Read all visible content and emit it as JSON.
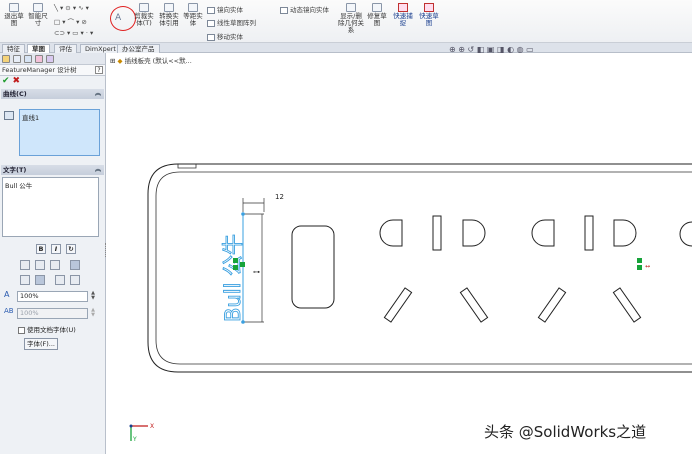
{
  "ribbon": {
    "buttons": [
      {
        "label": "退出草图",
        "name": "exit-sketch-button"
      },
      {
        "label": "智能尺寸",
        "name": "smart-dimension-button"
      },
      {
        "label": "剪裁实体(T)",
        "name": "trim-entities-button"
      },
      {
        "label": "转换实体引用",
        "name": "convert-entities-button"
      },
      {
        "label": "等距实体",
        "name": "offset-entities-button"
      },
      {
        "label": "显示/删除几何关系",
        "name": "display-relations-button"
      },
      {
        "label": "修复草图",
        "name": "repair-sketch-button"
      }
    ],
    "small_rows": {
      "mirror": "镜向实体",
      "linear_pattern": "线性草图阵列",
      "move": "移动实体",
      "dynamic_mirror": "动态镜向实体"
    },
    "quick_snaps": "快速捕捉",
    "quick_sketch": "快速草图"
  },
  "tabs": [
    "特征",
    "草图",
    "评估",
    "DimXpert",
    "办公室产品"
  ],
  "active_tab": "草图",
  "panel": {
    "title": "FeatureManager 设计树",
    "help": "?",
    "ok": "✔",
    "cancel": "✖",
    "curves_header": "曲线(C)",
    "curve_item": "直线1",
    "text_header": "文字(T)",
    "text_value": "Bull 公牛",
    "format_buttons": {
      "bold": "B",
      "italic": "I"
    },
    "width_value": "100%",
    "spacing_value": "100%",
    "use_doc_font": "使用文档字体(U)",
    "font_button": "字体(F)..."
  },
  "graphics": {
    "tree_item": "插线板壳  (默认<<默...",
    "dimension": "12",
    "sketch_text": "Bull 公牛",
    "watermark": "头条 @SolidWorks之道",
    "axis_x": "X",
    "axis_y": "Y"
  },
  "colors": {
    "accent_red": "#e02020",
    "sketch_blue": "#3aa0e0",
    "relation_green": "#17a33a"
  }
}
